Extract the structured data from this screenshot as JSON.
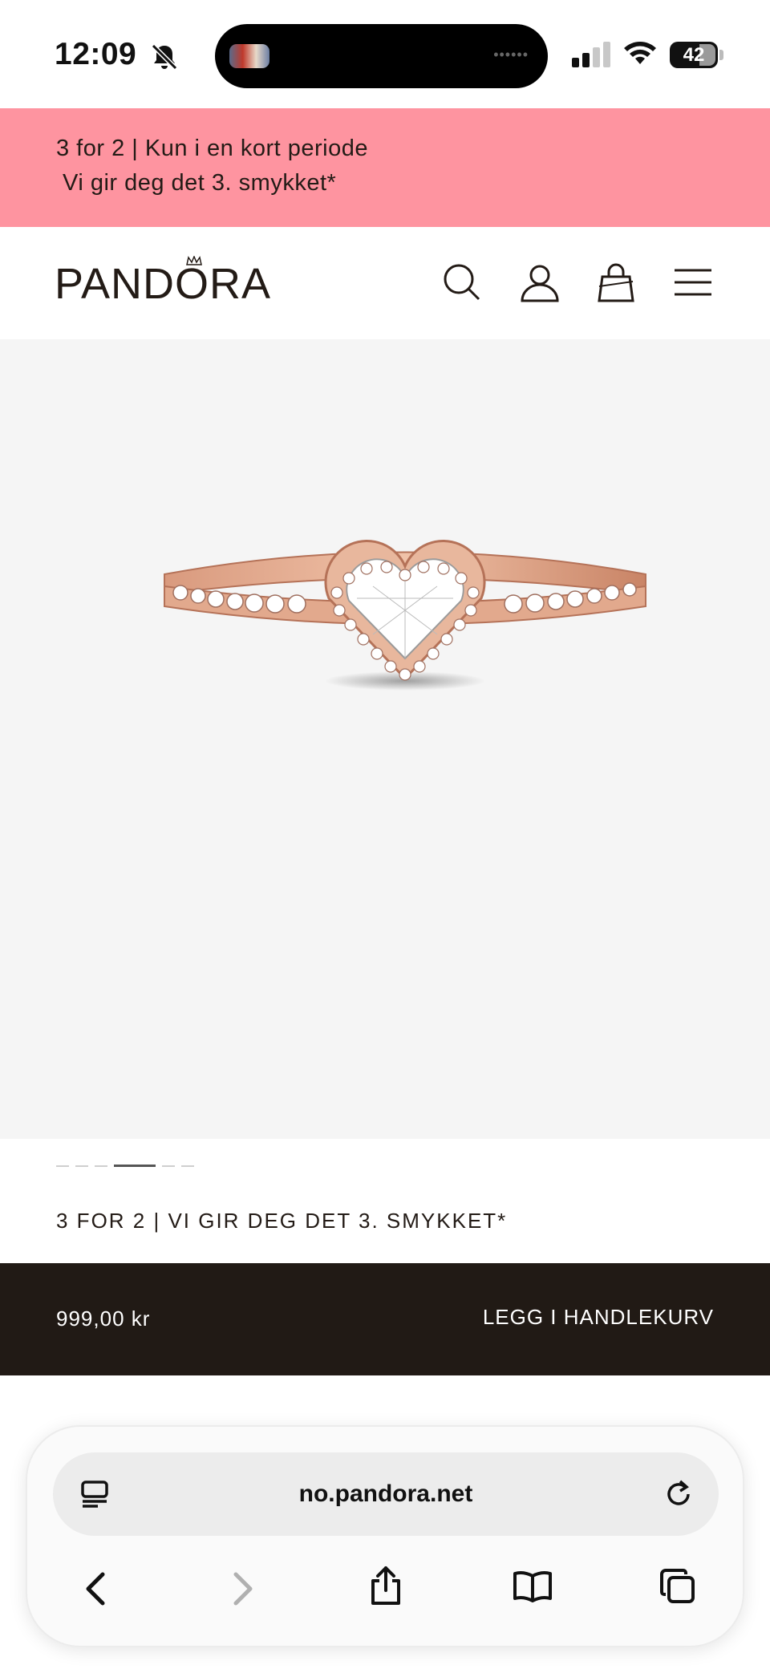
{
  "status_bar": {
    "time": "12:09",
    "battery": "42",
    "icons": [
      "bell-slash-icon",
      "signal-icon",
      "wifi-icon",
      "battery-icon"
    ]
  },
  "promo": {
    "line1": "3 for 2 | Kun i en kort periode",
    "line2": "Vi gir deg det 3. smykket*",
    "background": "#fe94a0"
  },
  "header": {
    "logo": "PANDORA",
    "icons": [
      "search-icon",
      "account-icon",
      "shopping-bag-icon",
      "menu-icon"
    ]
  },
  "product": {
    "image": "rose-gold-heart-ring",
    "carousel": {
      "count": 6,
      "active_index": 3
    },
    "offer_text": "3 FOR 2 | VI GIR DEG DET 3. SMYKKET*"
  },
  "buy_bar": {
    "price": "999,00 kr",
    "add_to_cart": "LEGG I HANDLEKURV",
    "background": "#211a15"
  },
  "browser": {
    "url": "no.pandora.net",
    "toolbar": [
      "reader-icon",
      "reload-icon",
      "back-icon",
      "forward-icon",
      "share-icon",
      "bookmarks-icon",
      "tabs-icon"
    ]
  }
}
